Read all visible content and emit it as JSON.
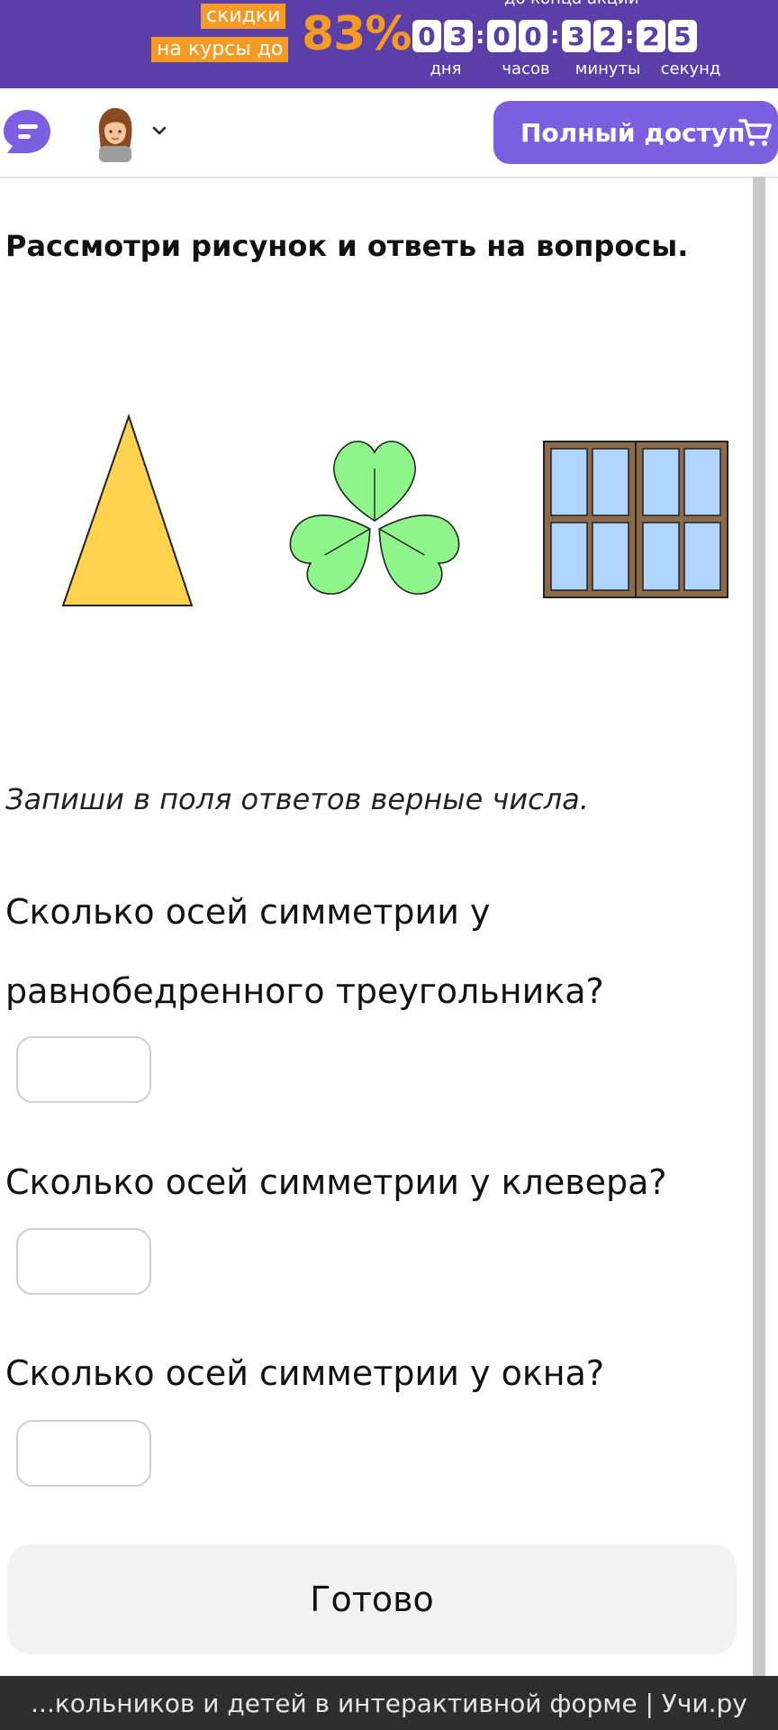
{
  "promo": {
    "top_text": "до конца акции",
    "tag1": "скидки",
    "tag2": "на курсы до",
    "percent": "83%",
    "digits": [
      "0",
      "3",
      "0",
      "0",
      "3",
      "2",
      "2",
      "5"
    ],
    "units": {
      "days": "дня",
      "hours": "часов",
      "minutes": "минуты",
      "seconds": "секунд"
    }
  },
  "header": {
    "full_access_label": "Полный доступ"
  },
  "task": {
    "title": "Рассмотри рисунок и ответь на вопросы.",
    "instruction": "Запиши в поля ответов верные числа.",
    "questions": [
      {
        "text": "Сколько осей симметрии у равнобедренного треугольника?",
        "answer": ""
      },
      {
        "text": "Сколько осей симметрии у клевера?",
        "answer": ""
      },
      {
        "text": "Сколько осей симметрии у окна?",
        "answer": ""
      }
    ],
    "submit_label": "Готово"
  },
  "colors": {
    "brand_purple": "#5b3fa8",
    "accent_orange": "#f59a23",
    "button_purple": "#7b5fe0"
  },
  "footer": {
    "text": "...кольников и детей в интерактивной форме | Учи.ру"
  }
}
